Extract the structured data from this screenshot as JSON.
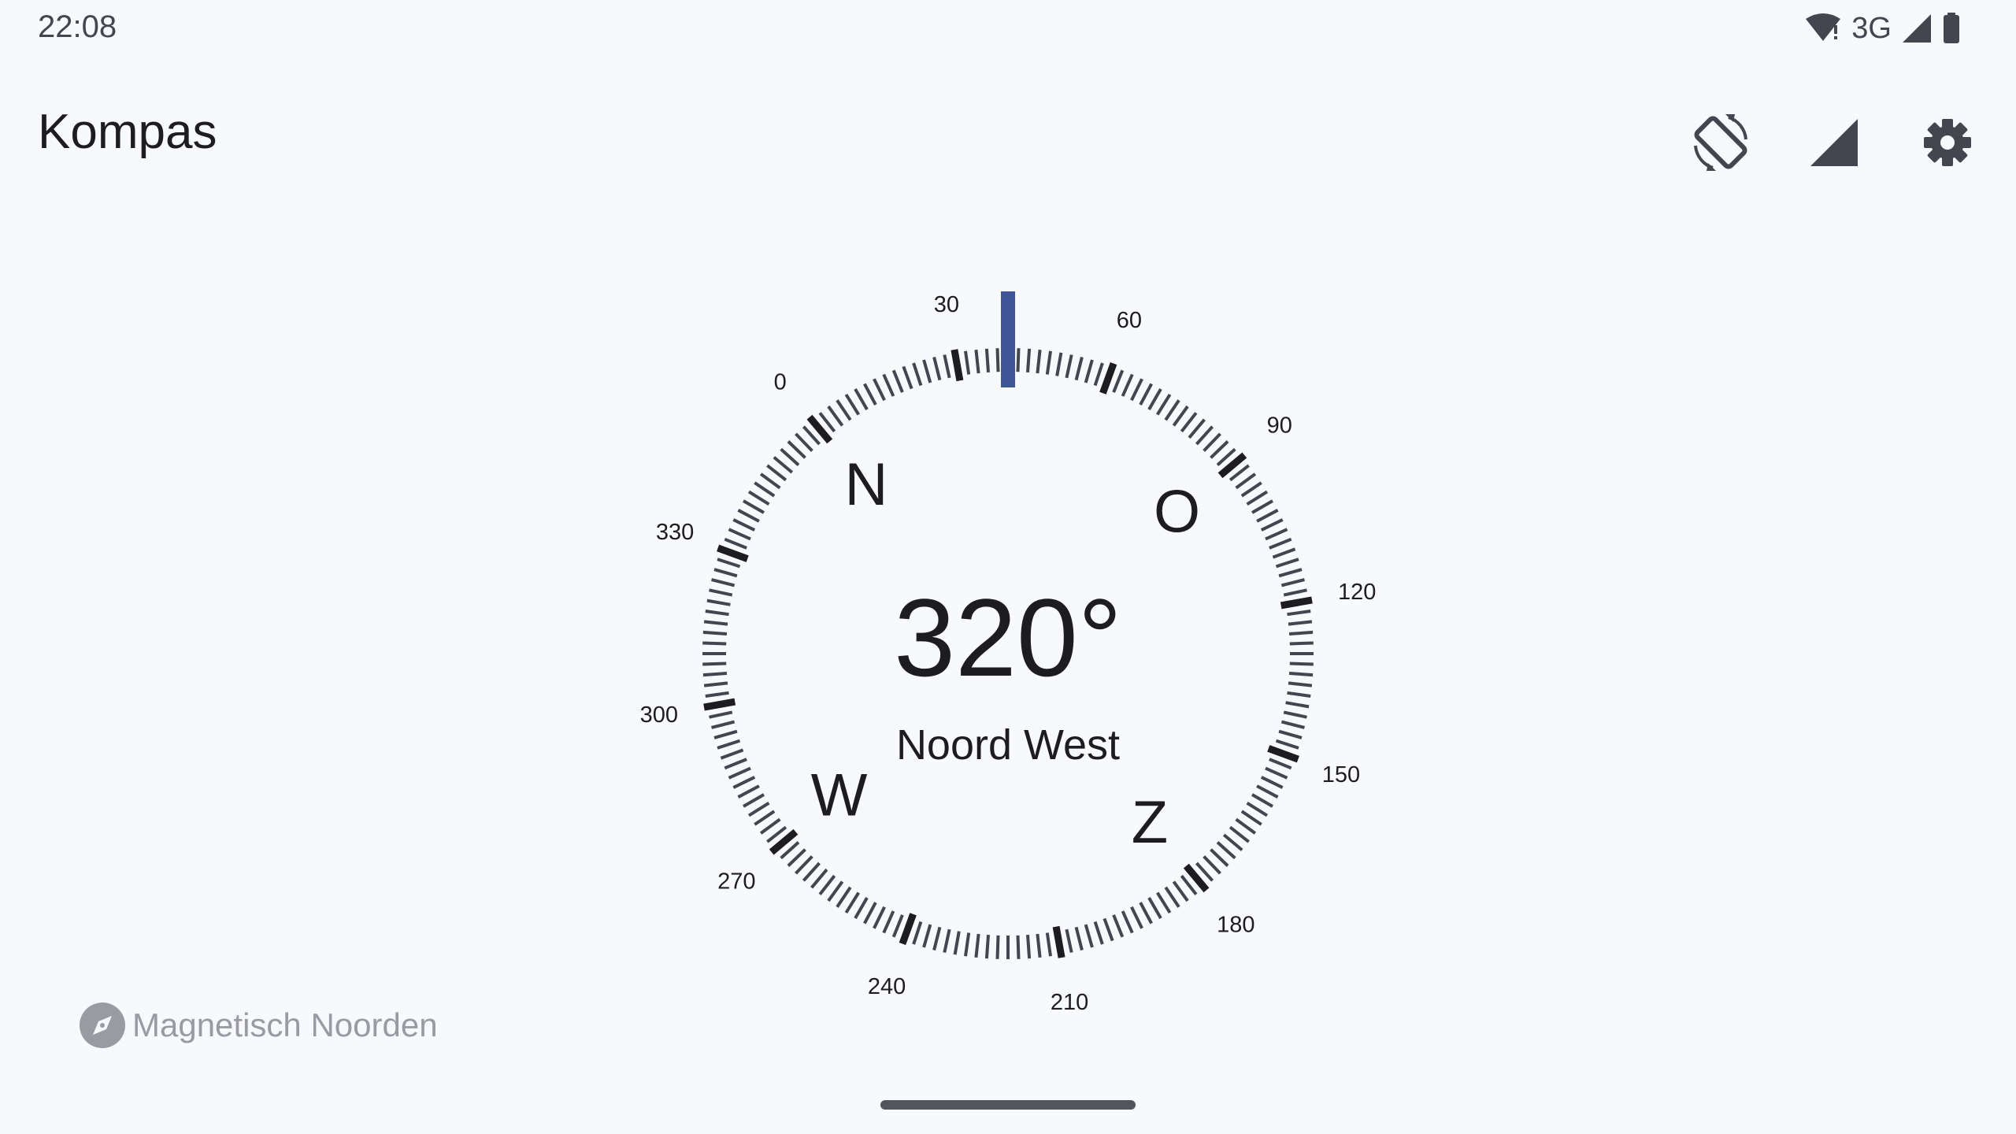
{
  "status_bar": {
    "time": "22:08",
    "network": "3G",
    "icons": [
      "wifi-alert-icon",
      "signal-icon",
      "battery-icon"
    ]
  },
  "app_bar": {
    "title": "Kompas",
    "actions": [
      {
        "name": "screen-rotation-icon"
      },
      {
        "name": "signal-strength-icon"
      },
      {
        "name": "settings-gear-icon"
      }
    ]
  },
  "compass": {
    "heading": "320°",
    "heading_degrees": 320,
    "direction": "Noord West",
    "dial_rotation_degrees": -40,
    "degree_labels": [
      "0",
      "30",
      "60",
      "90",
      "120",
      "150",
      "180",
      "210",
      "240",
      "270",
      "300",
      "330"
    ],
    "cardinal_labels": {
      "north": "N",
      "east": "O",
      "south": "Z",
      "west": "W"
    },
    "colors": {
      "indicator": "#3f5596",
      "major_tick": "#1c1c21",
      "minor_tick": "#44464f"
    }
  },
  "north_mode": {
    "label": "Magnetisch Noorden",
    "icon": "compass-icon"
  },
  "colors": {
    "background": "#f8f9fd",
    "text": "#1c1c21",
    "muted": "#9a9aa2",
    "icon": "#44464f"
  }
}
